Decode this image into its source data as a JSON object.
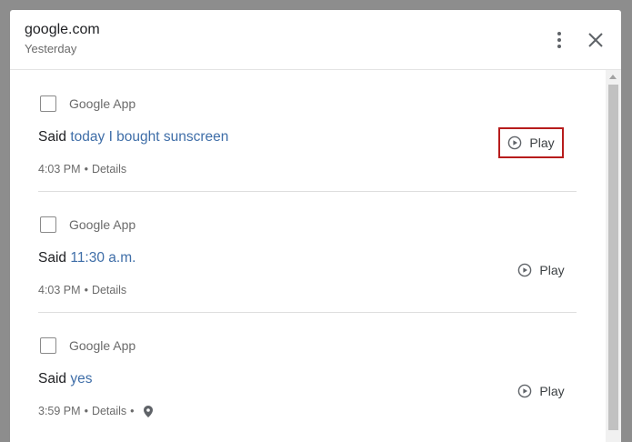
{
  "dialog": {
    "title": "google.com",
    "subtitle": "Yesterday"
  },
  "icons": {
    "more": "more-vert-icon",
    "close": "close-icon",
    "play": "play-circle-icon",
    "location": "location-pin-icon"
  },
  "colors": {
    "quote": "#3f6ea8",
    "highlight_border": "#b71c1c"
  },
  "items": [
    {
      "app": "Google App",
      "said_prefix": "Said",
      "quote": "today I bought sunscreen",
      "time": "4:03 PM",
      "separator": "•",
      "details": "Details",
      "play_label": "Play"
    },
    {
      "app": "Google App",
      "said_prefix": "Said",
      "quote": "11:30 a.m.",
      "time": "4:03 PM",
      "separator": "•",
      "details": "Details",
      "play_label": "Play"
    },
    {
      "app": "Google App",
      "said_prefix": "Said",
      "quote": "yes",
      "time": "3:59 PM",
      "separator": "•",
      "details": "Details",
      "play_label": "Play"
    }
  ]
}
